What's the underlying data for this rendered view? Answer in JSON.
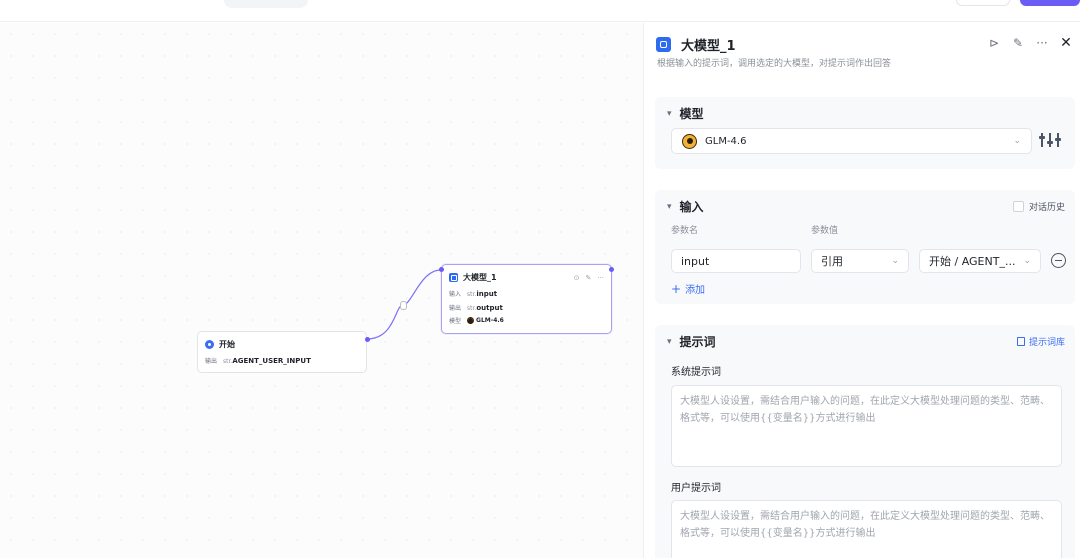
{
  "node_panel": {
    "title": "大模型_1",
    "description": "根据输入的提示词，调用选定的大模型，对提示词作出回答",
    "model_section": {
      "title": "模型",
      "selected_model": "GLM-4.6"
    },
    "input_section": {
      "title": "输入",
      "history_label": "对话历史",
      "col_param_name": "参数名",
      "col_param_value": "参数值",
      "param_name": "input",
      "value_type": "引用",
      "value_ref": "开始 / AGENT_...",
      "add_label": "添加"
    },
    "prompt_section": {
      "title": "提示词",
      "library_label": "提示词库",
      "system_label": "系统提示词",
      "system_placeholder": "大模型人设设置，需结合用户输入的问题，在此定义大模型处理问题的类型、范畴、格式等，可以使用{{变量名}}方式进行输出",
      "user_label": "用户提示词",
      "user_placeholder": "大模型人设设置，需结合用户输入的问题，在此定义大模型处理问题的类型、范畴、格式等，可以使用{{变量名}}方式进行输出"
    }
  },
  "canvas": {
    "start_node": {
      "title": "开始",
      "output_label": "输出",
      "output_type": "str.",
      "output_name": "AGENT_USER_INPUT"
    },
    "llm_node": {
      "title": "大模型_1",
      "input_label": "输入",
      "input_type": "str.",
      "input_name": "input",
      "output_label": "输出",
      "output_type": "str.",
      "output_name": "output",
      "model_label": "模型",
      "model_name": "GLM-4.6"
    }
  },
  "colors": {
    "accent": "#6a5cf5",
    "link": "#3b6cf6",
    "node_icon": "#2f6bf0"
  }
}
